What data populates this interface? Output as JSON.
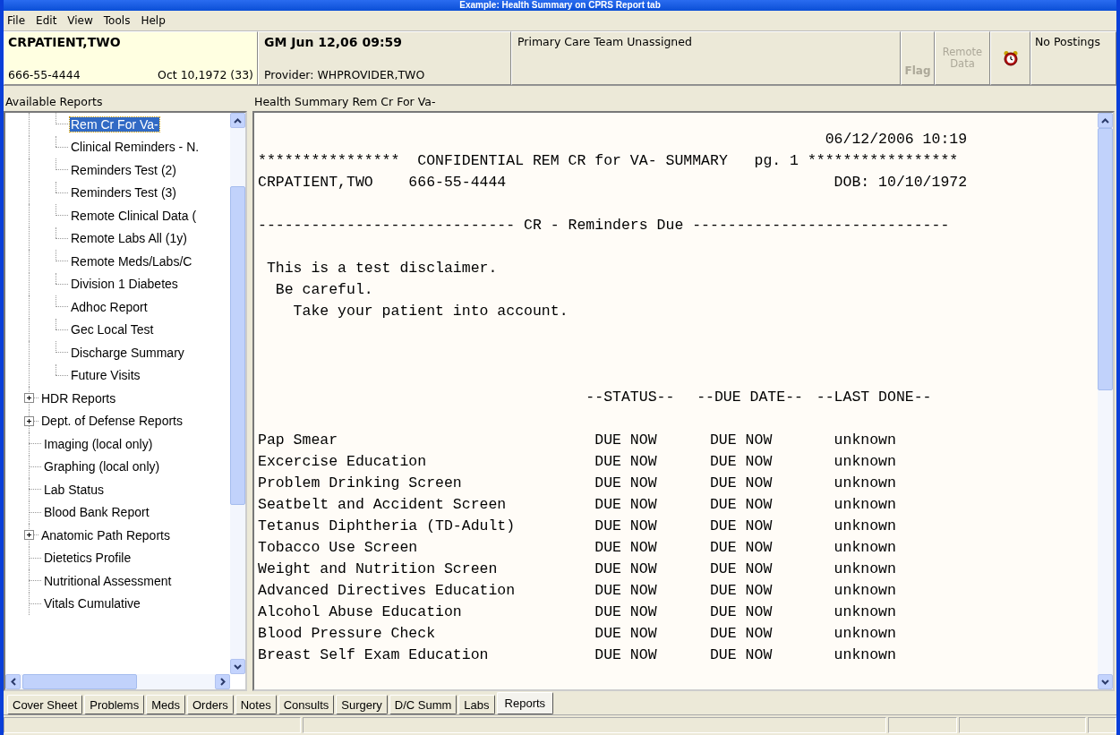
{
  "window": {
    "title": "Example: Health Summary on CPRS Report tab"
  },
  "menu": [
    "File",
    "Edit",
    "View",
    "Tools",
    "Help"
  ],
  "header": {
    "patient": {
      "name": "CRPATIENT,TWO",
      "ssn": "666-55-4444",
      "dob": "Oct 10,1972 (33)"
    },
    "encounter": {
      "location": "GM Jun 12,06 09:59",
      "provider": "Provider:  WHPROVIDER,TWO"
    },
    "team": "Primary Care Team Unassigned",
    "flag": {
      "label": "Flag",
      "disabled": true
    },
    "remote_data": {
      "label": "Remote Data",
      "disabled": true
    },
    "postings": "No Postings"
  },
  "reports_tree": {
    "title": "Available Reports",
    "items": [
      {
        "kind": "group",
        "children": [
          {
            "label": "Rem Cr For Va-",
            "selected": true
          },
          {
            "label": "Clinical Reminders - N.",
            "selected": false
          },
          {
            "label": "Reminders Test (2)",
            "selected": false
          },
          {
            "label": "Reminders Test (3)",
            "selected": false
          },
          {
            "label": "Remote Clinical Data (",
            "selected": false
          },
          {
            "label": "Remote Labs All (1y)",
            "selected": false
          },
          {
            "label": "Remote Meds/Labs/C",
            "selected": false
          },
          {
            "label": "Division 1 Diabetes",
            "selected": false
          },
          {
            "label": "Adhoc Report",
            "selected": false
          },
          {
            "label": "Gec Local Test",
            "selected": false
          },
          {
            "label": "Discharge Summary",
            "selected": false
          },
          {
            "label": "Future Visits",
            "selected": false
          }
        ]
      },
      {
        "label": "HDR Reports",
        "selected": false,
        "kind": "folder",
        "expanded": false
      },
      {
        "label": "Dept. of Defense Reports",
        "selected": false,
        "kind": "folder",
        "expanded": false
      },
      {
        "label": "Imaging (local only)",
        "selected": false,
        "kind": "leaf"
      },
      {
        "label": "Graphing (local only)",
        "selected": false,
        "kind": "leaf"
      },
      {
        "label": "Lab Status",
        "selected": false,
        "kind": "leaf"
      },
      {
        "label": "Blood Bank Report",
        "selected": false,
        "kind": "leaf"
      },
      {
        "label": "Anatomic Path Reports",
        "selected": false,
        "kind": "folder",
        "expanded": false
      },
      {
        "label": "Dietetics Profile",
        "selected": false,
        "kind": "leaf"
      },
      {
        "label": "Nutritional Assessment",
        "selected": false,
        "kind": "leaf"
      },
      {
        "label": "Vitals Cumulative",
        "selected": false,
        "kind": "leaf"
      }
    ]
  },
  "report": {
    "title": "Health Summary Rem Cr For Va-",
    "lines": [
      {
        "kind": "date",
        "text": "06/12/2006 10:19"
      },
      {
        "kind": "banner",
        "text": "****************  CONFIDENTIAL REM CR for VA- SUMMARY   pg. 1 *****************"
      },
      {
        "kind": "patient",
        "left": "CRPATIENT,TWO    666-55-4444",
        "right": "DOB: 10/10/1972"
      },
      {
        "kind": "section",
        "text": "----------------------------- CR - Reminders Due -----------------------------"
      },
      {
        "kind": "text",
        "text": " This is a test disclaimer."
      },
      {
        "kind": "text",
        "text": "  Be careful."
      },
      {
        "kind": "text",
        "text": "    Take your patient into account."
      }
    ],
    "columns": [
      "--STATUS--",
      "--DUE DATE--",
      "--LAST DONE--"
    ],
    "rows": [
      {
        "name": "Pap Smear",
        "status": "DUE NOW",
        "due": "DUE NOW",
        "last": "unknown"
      },
      {
        "name": "Excercise Education",
        "status": "DUE NOW",
        "due": "DUE NOW",
        "last": "unknown"
      },
      {
        "name": "Problem Drinking Screen",
        "status": "DUE NOW",
        "due": "DUE NOW",
        "last": "unknown"
      },
      {
        "name": "Seatbelt and Accident Screen",
        "status": "DUE NOW",
        "due": "DUE NOW",
        "last": "unknown"
      },
      {
        "name": "Tetanus Diphtheria (TD-Adult)",
        "status": "DUE NOW",
        "due": "DUE NOW",
        "last": "unknown"
      },
      {
        "name": "Tobacco Use Screen",
        "status": "DUE NOW",
        "due": "DUE NOW",
        "last": "unknown"
      },
      {
        "name": "Weight and Nutrition Screen",
        "status": "DUE NOW",
        "due": "DUE NOW",
        "last": "unknown"
      },
      {
        "name": "Advanced Directives Education",
        "status": "DUE NOW",
        "due": "DUE NOW",
        "last": "unknown"
      },
      {
        "name": "Alcohol Abuse Education",
        "status": "DUE NOW",
        "due": "DUE NOW",
        "last": "unknown"
      },
      {
        "name": "Blood Pressure Check",
        "status": "DUE NOW",
        "due": "DUE NOW",
        "last": "unknown"
      },
      {
        "name": "Breast Self Exam Education",
        "status": "DUE NOW",
        "due": "DUE NOW",
        "last": "unknown"
      }
    ]
  },
  "tabs": [
    {
      "label": "Cover Sheet",
      "selected": false
    },
    {
      "label": "Problems",
      "selected": false
    },
    {
      "label": "Meds",
      "selected": false
    },
    {
      "label": "Orders",
      "selected": false
    },
    {
      "label": "Notes",
      "selected": false
    },
    {
      "label": "Consults",
      "selected": false
    },
    {
      "label": "Surgery",
      "selected": false
    },
    {
      "label": "D/C Summ",
      "selected": false
    },
    {
      "label": "Labs",
      "selected": false
    },
    {
      "label": "Reports",
      "selected": true
    }
  ]
}
